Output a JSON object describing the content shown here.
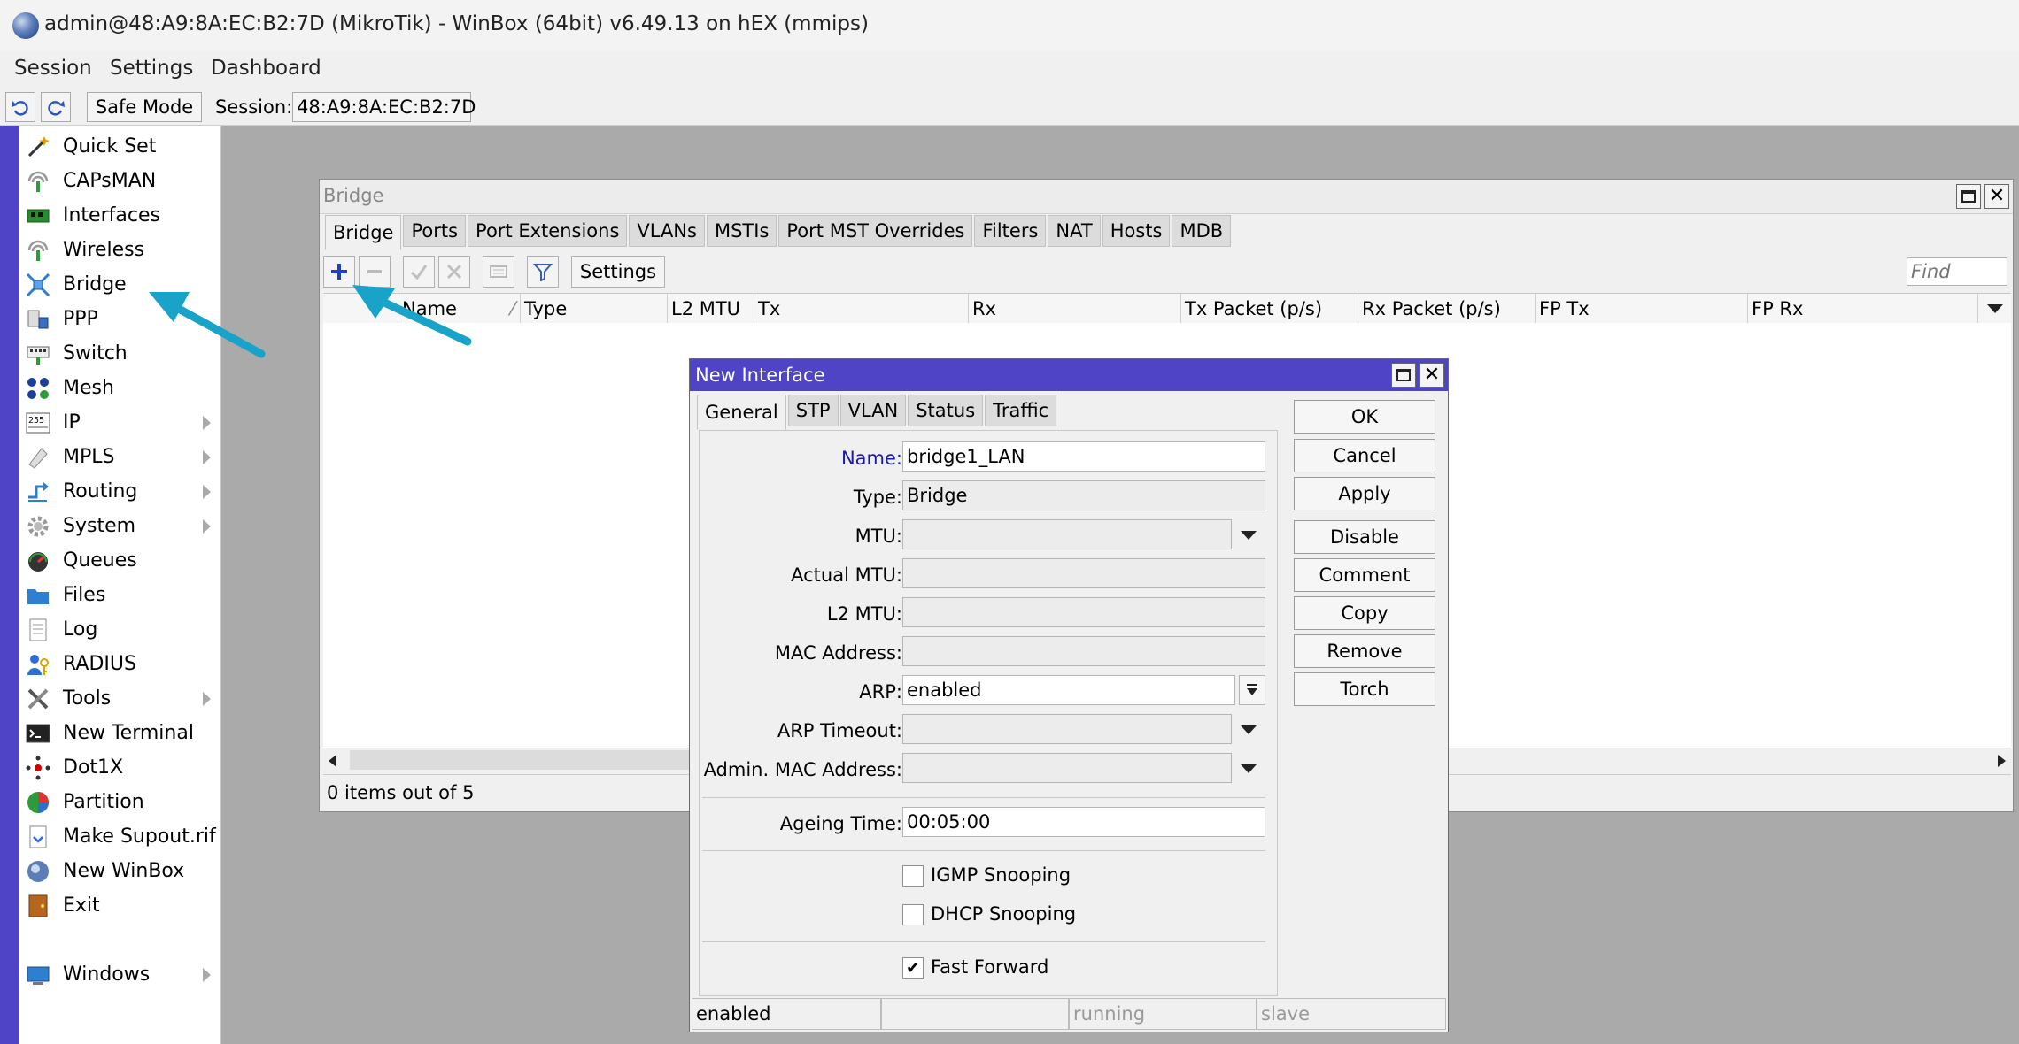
{
  "window": {
    "title": "admin@48:A9:8A:EC:B2:7D (MikroTik) - WinBox (64bit) v6.49.13 on hEX (mmips)"
  },
  "menubar": {
    "items": [
      "Session",
      "Settings",
      "Dashboard"
    ]
  },
  "toolbar": {
    "safe_mode_label": "Safe Mode",
    "session_label": "Session:",
    "session_value": "48:A9:8A:EC:B2:7D"
  },
  "sidebar": {
    "items": [
      {
        "label": "Quick Set",
        "icon": "wand-icon",
        "submenu": false
      },
      {
        "label": "CAPsMAN",
        "icon": "antenna-icon",
        "submenu": false
      },
      {
        "label": "Interfaces",
        "icon": "network-card-icon",
        "submenu": false
      },
      {
        "label": "Wireless",
        "icon": "wireless-icon",
        "submenu": false
      },
      {
        "label": "Bridge",
        "icon": "bridge-icon",
        "submenu": false
      },
      {
        "label": "PPP",
        "icon": "ppp-icon",
        "submenu": false
      },
      {
        "label": "Switch",
        "icon": "switch-icon",
        "submenu": false
      },
      {
        "label": "Mesh",
        "icon": "mesh-icon",
        "submenu": false
      },
      {
        "label": "IP",
        "icon": "ip-icon",
        "submenu": true
      },
      {
        "label": "MPLS",
        "icon": "mpls-icon",
        "submenu": true
      },
      {
        "label": "Routing",
        "icon": "routing-icon",
        "submenu": true
      },
      {
        "label": "System",
        "icon": "gear-icon",
        "submenu": true
      },
      {
        "label": "Queues",
        "icon": "queues-icon",
        "submenu": false
      },
      {
        "label": "Files",
        "icon": "folder-icon",
        "submenu": false
      },
      {
        "label": "Log",
        "icon": "log-icon",
        "submenu": false
      },
      {
        "label": "RADIUS",
        "icon": "radius-icon",
        "submenu": false
      },
      {
        "label": "Tools",
        "icon": "tools-icon",
        "submenu": true
      },
      {
        "label": "New Terminal",
        "icon": "terminal-icon",
        "submenu": false
      },
      {
        "label": "Dot1X",
        "icon": "dot1x-icon",
        "submenu": false
      },
      {
        "label": "Partition",
        "icon": "partition-icon",
        "submenu": false
      },
      {
        "label": "Make Supout.rif",
        "icon": "supout-icon",
        "submenu": false
      },
      {
        "label": "New WinBox",
        "icon": "winbox-icon",
        "submenu": false
      },
      {
        "label": "Exit",
        "icon": "exit-icon",
        "submenu": false
      },
      {
        "label": "Windows",
        "icon": "windows-icon",
        "submenu": true
      }
    ]
  },
  "bridge_window": {
    "title": "Bridge",
    "tabs": [
      "Bridge",
      "Ports",
      "Port Extensions",
      "VLANs",
      "MSTIs",
      "Port MST Overrides",
      "Filters",
      "NAT",
      "Hosts",
      "MDB"
    ],
    "settings_label": "Settings",
    "find_placeholder": "Find",
    "columns": [
      "Name",
      "Type",
      "L2 MTU",
      "Tx",
      "Rx",
      "Tx Packet (p/s)",
      "Rx Packet (p/s)",
      "FP Tx",
      "FP Rx"
    ],
    "status": "0 items out of 5"
  },
  "dialog": {
    "title": "New Interface",
    "tabs": [
      "General",
      "STP",
      "VLAN",
      "Status",
      "Traffic"
    ],
    "fields": {
      "name": {
        "label": "Name:",
        "value": "bridge1_LAN"
      },
      "type": {
        "label": "Type:",
        "value": "Bridge"
      },
      "mtu": {
        "label": "MTU:",
        "value": ""
      },
      "actual_mtu": {
        "label": "Actual MTU:",
        "value": ""
      },
      "l2_mtu": {
        "label": "L2 MTU:",
        "value": ""
      },
      "mac_address": {
        "label": "MAC Address:",
        "value": ""
      },
      "arp": {
        "label": "ARP:",
        "value": "enabled"
      },
      "arp_timeout": {
        "label": "ARP Timeout:",
        "value": ""
      },
      "admin_mac": {
        "label": "Admin. MAC Address:",
        "value": ""
      },
      "ageing_time": {
        "label": "Ageing Time:",
        "value": "00:05:00"
      }
    },
    "checkboxes": {
      "igmp_snooping": {
        "label": "IGMP Snooping",
        "checked": false
      },
      "dhcp_snooping": {
        "label": "DHCP Snooping",
        "checked": false
      },
      "fast_forward": {
        "label": "Fast Forward",
        "checked": true,
        "mark": "✔"
      }
    },
    "buttons": [
      "OK",
      "Cancel",
      "Apply",
      "Disable",
      "Comment",
      "Copy",
      "Remove",
      "Torch"
    ],
    "status": {
      "s1": "enabled",
      "s2": "",
      "s3": "running",
      "s4": "slave"
    }
  },
  "colors": {
    "accent": "#4e44c5",
    "annotation_arrow": "#1aa3c9",
    "add_icon": "#1f3fbf",
    "workspace": "#aaaaaa"
  }
}
